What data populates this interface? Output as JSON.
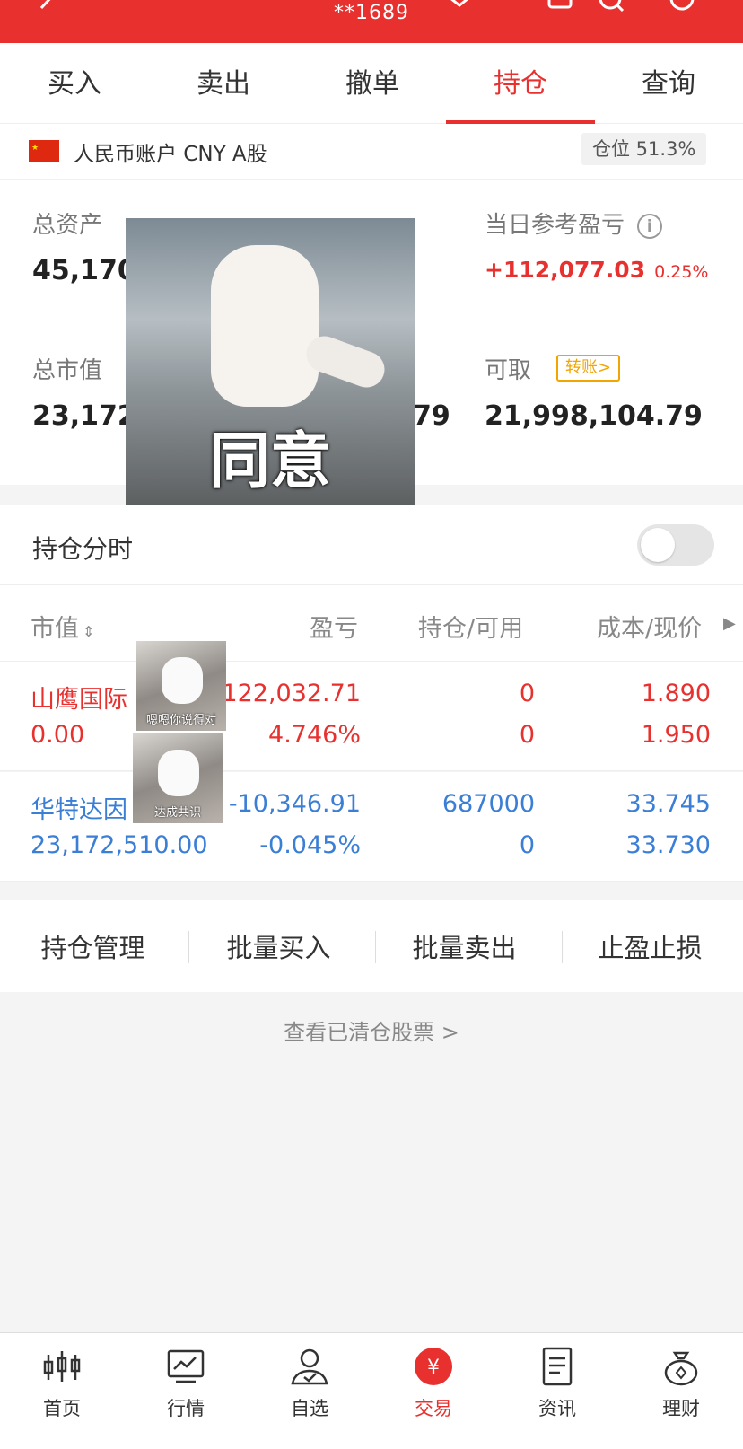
{
  "header": {
    "account": "**1689"
  },
  "tabs": [
    {
      "label": "买入"
    },
    {
      "label": "卖出"
    },
    {
      "label": "撤单"
    },
    {
      "label": "持仓"
    },
    {
      "label": "查询"
    }
  ],
  "account_row": {
    "label": "人民币账户 CNY A股",
    "position": "仓位 51.3%"
  },
  "summary": {
    "total_assets_label": "总资产",
    "total_assets_value": "45,170,",
    "day_pl_label": "当日参考盈亏",
    "day_pl_value": "+112,077.03",
    "day_pl_pct": "0.25%",
    "market_value_label": "总市值",
    "market_value_value": "23,172,",
    "hidden_tail_value": "79",
    "withdrawable_label": "可取",
    "transfer_label": "转账>",
    "withdrawable_value": "21,998,104.79"
  },
  "meme": {
    "caption": "同意"
  },
  "timeshare": {
    "label": "持仓分时",
    "enabled": false
  },
  "table": {
    "headers": {
      "market_value": "市值",
      "pl": "盈亏",
      "holding": "持仓/可用",
      "cost": "成本/现价"
    },
    "rows": [
      {
        "name": "山鹰国际",
        "market_value": "0.00",
        "pl": "122,032.71",
        "pl_pct": "4.746%",
        "holding": "0",
        "available": "0",
        "cost": "1.890",
        "price": "1.950"
      },
      {
        "name": "华特达因",
        "market_value": "23,172,510.00",
        "pl": "-10,346.91",
        "pl_pct": "-0.045%",
        "holding": "687000",
        "available": "0",
        "cost": "33.745",
        "price": "33.730"
      }
    ],
    "thumbs": [
      {
        "caption": "嗯嗯你说得对"
      },
      {
        "caption": "达成共识"
      }
    ]
  },
  "actions": [
    {
      "label": "持仓管理"
    },
    {
      "label": "批量买入"
    },
    {
      "label": "批量卖出"
    },
    {
      "label": "止盈止损"
    }
  ],
  "cleared_link": "查看已清仓股票 >",
  "bottom_nav": [
    {
      "label": "首页",
      "icon": "candlestick-icon"
    },
    {
      "label": "行情",
      "icon": "chart-icon"
    },
    {
      "label": "自选",
      "icon": "user-check-icon"
    },
    {
      "label": "交易",
      "icon": "yuan-icon"
    },
    {
      "label": "资讯",
      "icon": "document-icon"
    },
    {
      "label": "理财",
      "icon": "money-bag-icon"
    }
  ],
  "colors": {
    "brand_red": "#e8312f",
    "rise": "#e8312f",
    "fall": "#3a7ed6",
    "transfer_accent": "#f0a500"
  }
}
